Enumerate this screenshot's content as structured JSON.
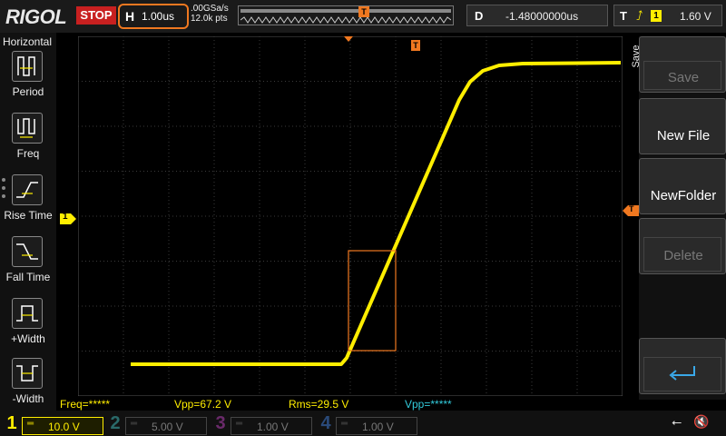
{
  "top": {
    "logo": "RIGOL",
    "run_state": "STOP",
    "horizontal_label": "H",
    "timebase": "1.00us",
    "sample_rate": ".00GSa/s",
    "memory_depth": "12.0k pts",
    "trigger_marker": "T",
    "delay_label": "D",
    "delay_value": "-1.48000000us",
    "trigger_label": "T",
    "trigger_edge": "rising-edge-icon",
    "trigger_channel": "1",
    "trigger_level": "1.60 V"
  },
  "left_menu": {
    "title": "Horizontal",
    "items": [
      {
        "label": "Period",
        "icon": "period-icon"
      },
      {
        "label": "Freq",
        "icon": "frequency-icon"
      },
      {
        "label": "Rise Time",
        "icon": "rise-time-icon"
      },
      {
        "label": "Fall Time",
        "icon": "fall-time-icon"
      },
      {
        "label": "+Width",
        "icon": "positive-width-icon"
      },
      {
        "label": "-Width",
        "icon": "negative-width-icon"
      }
    ]
  },
  "right_menu": {
    "title": "Save",
    "buttons": [
      {
        "label": "Save",
        "enabled": false
      },
      {
        "label": "New File",
        "enabled": true
      },
      {
        "label": "NewFolder",
        "enabled": true
      },
      {
        "label": "Delete",
        "enabled": false
      },
      {
        "label": "",
        "icon": "enter-icon",
        "enabled": true
      }
    ]
  },
  "channel_markers": {
    "ch1": "1",
    "trigger_level_marker": "T"
  },
  "measurements": {
    "freq": "Freq=*****",
    "vpp1": "Vpp=67.2 V",
    "rms": "Rms=29.5 V",
    "vpp2": "Vpp=*****"
  },
  "channels": [
    {
      "num": "1",
      "scale": "10.0 V",
      "color": "#ffee00",
      "active": true
    },
    {
      "num": "2",
      "scale": "5.00 V",
      "color": "#33bbbb",
      "active": false
    },
    {
      "num": "3",
      "scale": "1.00 V",
      "color": "#cc44cc",
      "active": false
    },
    {
      "num": "4",
      "scale": "1.00 V",
      "color": "#4488dd",
      "active": false
    }
  ],
  "status_icons": [
    "usb-icon",
    "sound-muted-icon"
  ],
  "colors": {
    "ch1_trace": "#ffee00",
    "accent_orange": "#f07820",
    "measure_text": "#ffee00",
    "measure_text_alt": "#33ccdd"
  }
}
